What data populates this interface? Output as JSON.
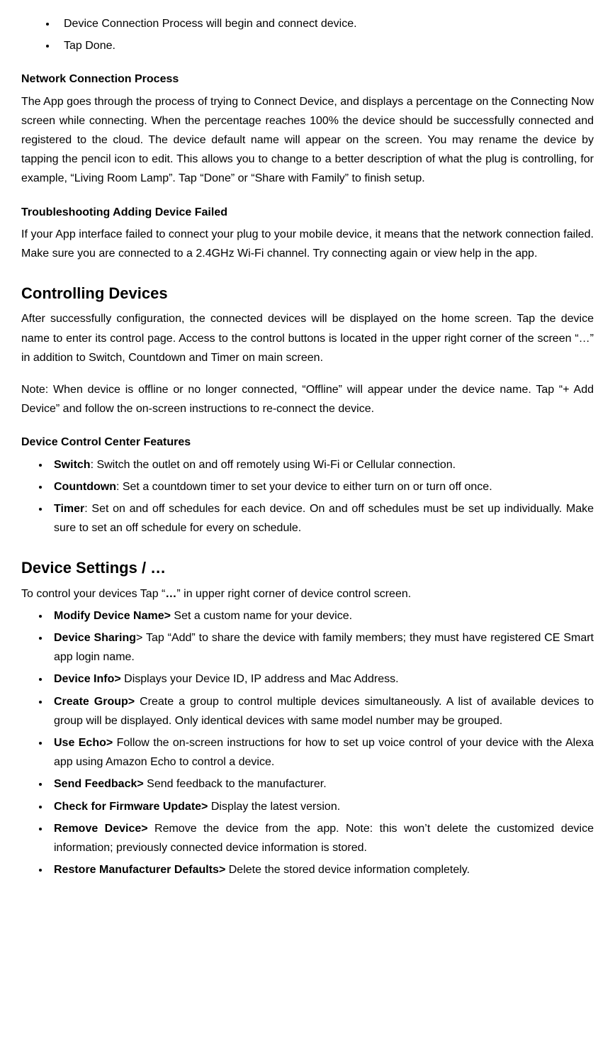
{
  "intro_bullets": [
    "Device Connection Process will begin and connect device.",
    "Tap Done."
  ],
  "network": {
    "heading": "Network Connection Process",
    "body": "The App goes through the process of trying to Connect Device, and displays a percentage on the Connecting Now screen while connecting.  When the percentage reaches 100% the device should be successfully connected and registered to the cloud. The device default name will appear on the screen. You may rename the device by tapping the pencil icon to edit. This allows you to change to a better description of what the plug is controlling, for example, “Living Room Lamp”. Tap “Done” or “Share with Family” to finish setup."
  },
  "troubleshoot": {
    "heading": "Troubleshooting Adding Device Failed",
    "body": "If your App interface failed to connect your plug to your mobile device, it means that the network connection failed. Make sure you are connected to a 2.4GHz Wi-Fi channel. Try connecting again or view help in the app."
  },
  "controlling": {
    "heading": "Controlling Devices",
    "p1": "After successfully configuration, the connected devices will be displayed on the home screen. Tap the device name to enter its control page.  Access to the control buttons is located in the upper right corner of the screen “…” in addition to Switch, Countdown and Timer on main screen.",
    "p2": "Note: When device is offline or no longer connected, “Offline” will appear under the device name. Tap “+ Add Device” and follow the on-screen instructions to re-connect the device."
  },
  "features": {
    "heading": "Device Control Center Features",
    "items": [
      {
        "name": "Switch",
        "desc": ": Switch the outlet on and off remotely using Wi-Fi or Cellular connection."
      },
      {
        "name": "Countdown",
        "desc": ": Set a countdown timer to set your device to either turn on or turn off once."
      },
      {
        "name": "Timer",
        "desc": ": Set on and off schedules for each device. On and off schedules must be set up individually. Make sure to set an off schedule for every on schedule."
      }
    ]
  },
  "settings": {
    "heading": "Device Settings / …",
    "intro_pre": "To control your devices Tap “",
    "intro_bold": "…",
    "intro_post": "” in upper right corner of device control screen.",
    "items": [
      {
        "name": "Modify Device Name>",
        "desc": " Set a custom name for your device."
      },
      {
        "name": "Device Sharing",
        "desc": "> Tap “Add” to share the device with family members; they must have registered CE Smart app login name."
      },
      {
        "name": "Device Info>",
        "desc": " Displays your Device ID, IP address and Mac Address."
      },
      {
        "name": "Create Group>",
        "desc": " Create a group to control multiple devices simultaneously. A list of available devices to group will be displayed. Only identical devices with same model number may be grouped."
      },
      {
        "name": "Use Echo>",
        "desc": " Follow the on-screen instructions for how to set up voice control of your device with the Alexa app using Amazon Echo to control a device."
      },
      {
        "name": "Send Feedback>",
        "desc": " Send feedback to the manufacturer."
      },
      {
        "name": "Check for Firmware Update>",
        "desc": " Display the latest version."
      },
      {
        "name": "Remove Device>",
        "desc": " Remove the device from the app. Note: this won’t delete the customized device information; previously connected device information is stored."
      },
      {
        "name": "Restore Manufacturer Defaults>",
        "desc": " Delete the stored device information completely."
      }
    ]
  }
}
